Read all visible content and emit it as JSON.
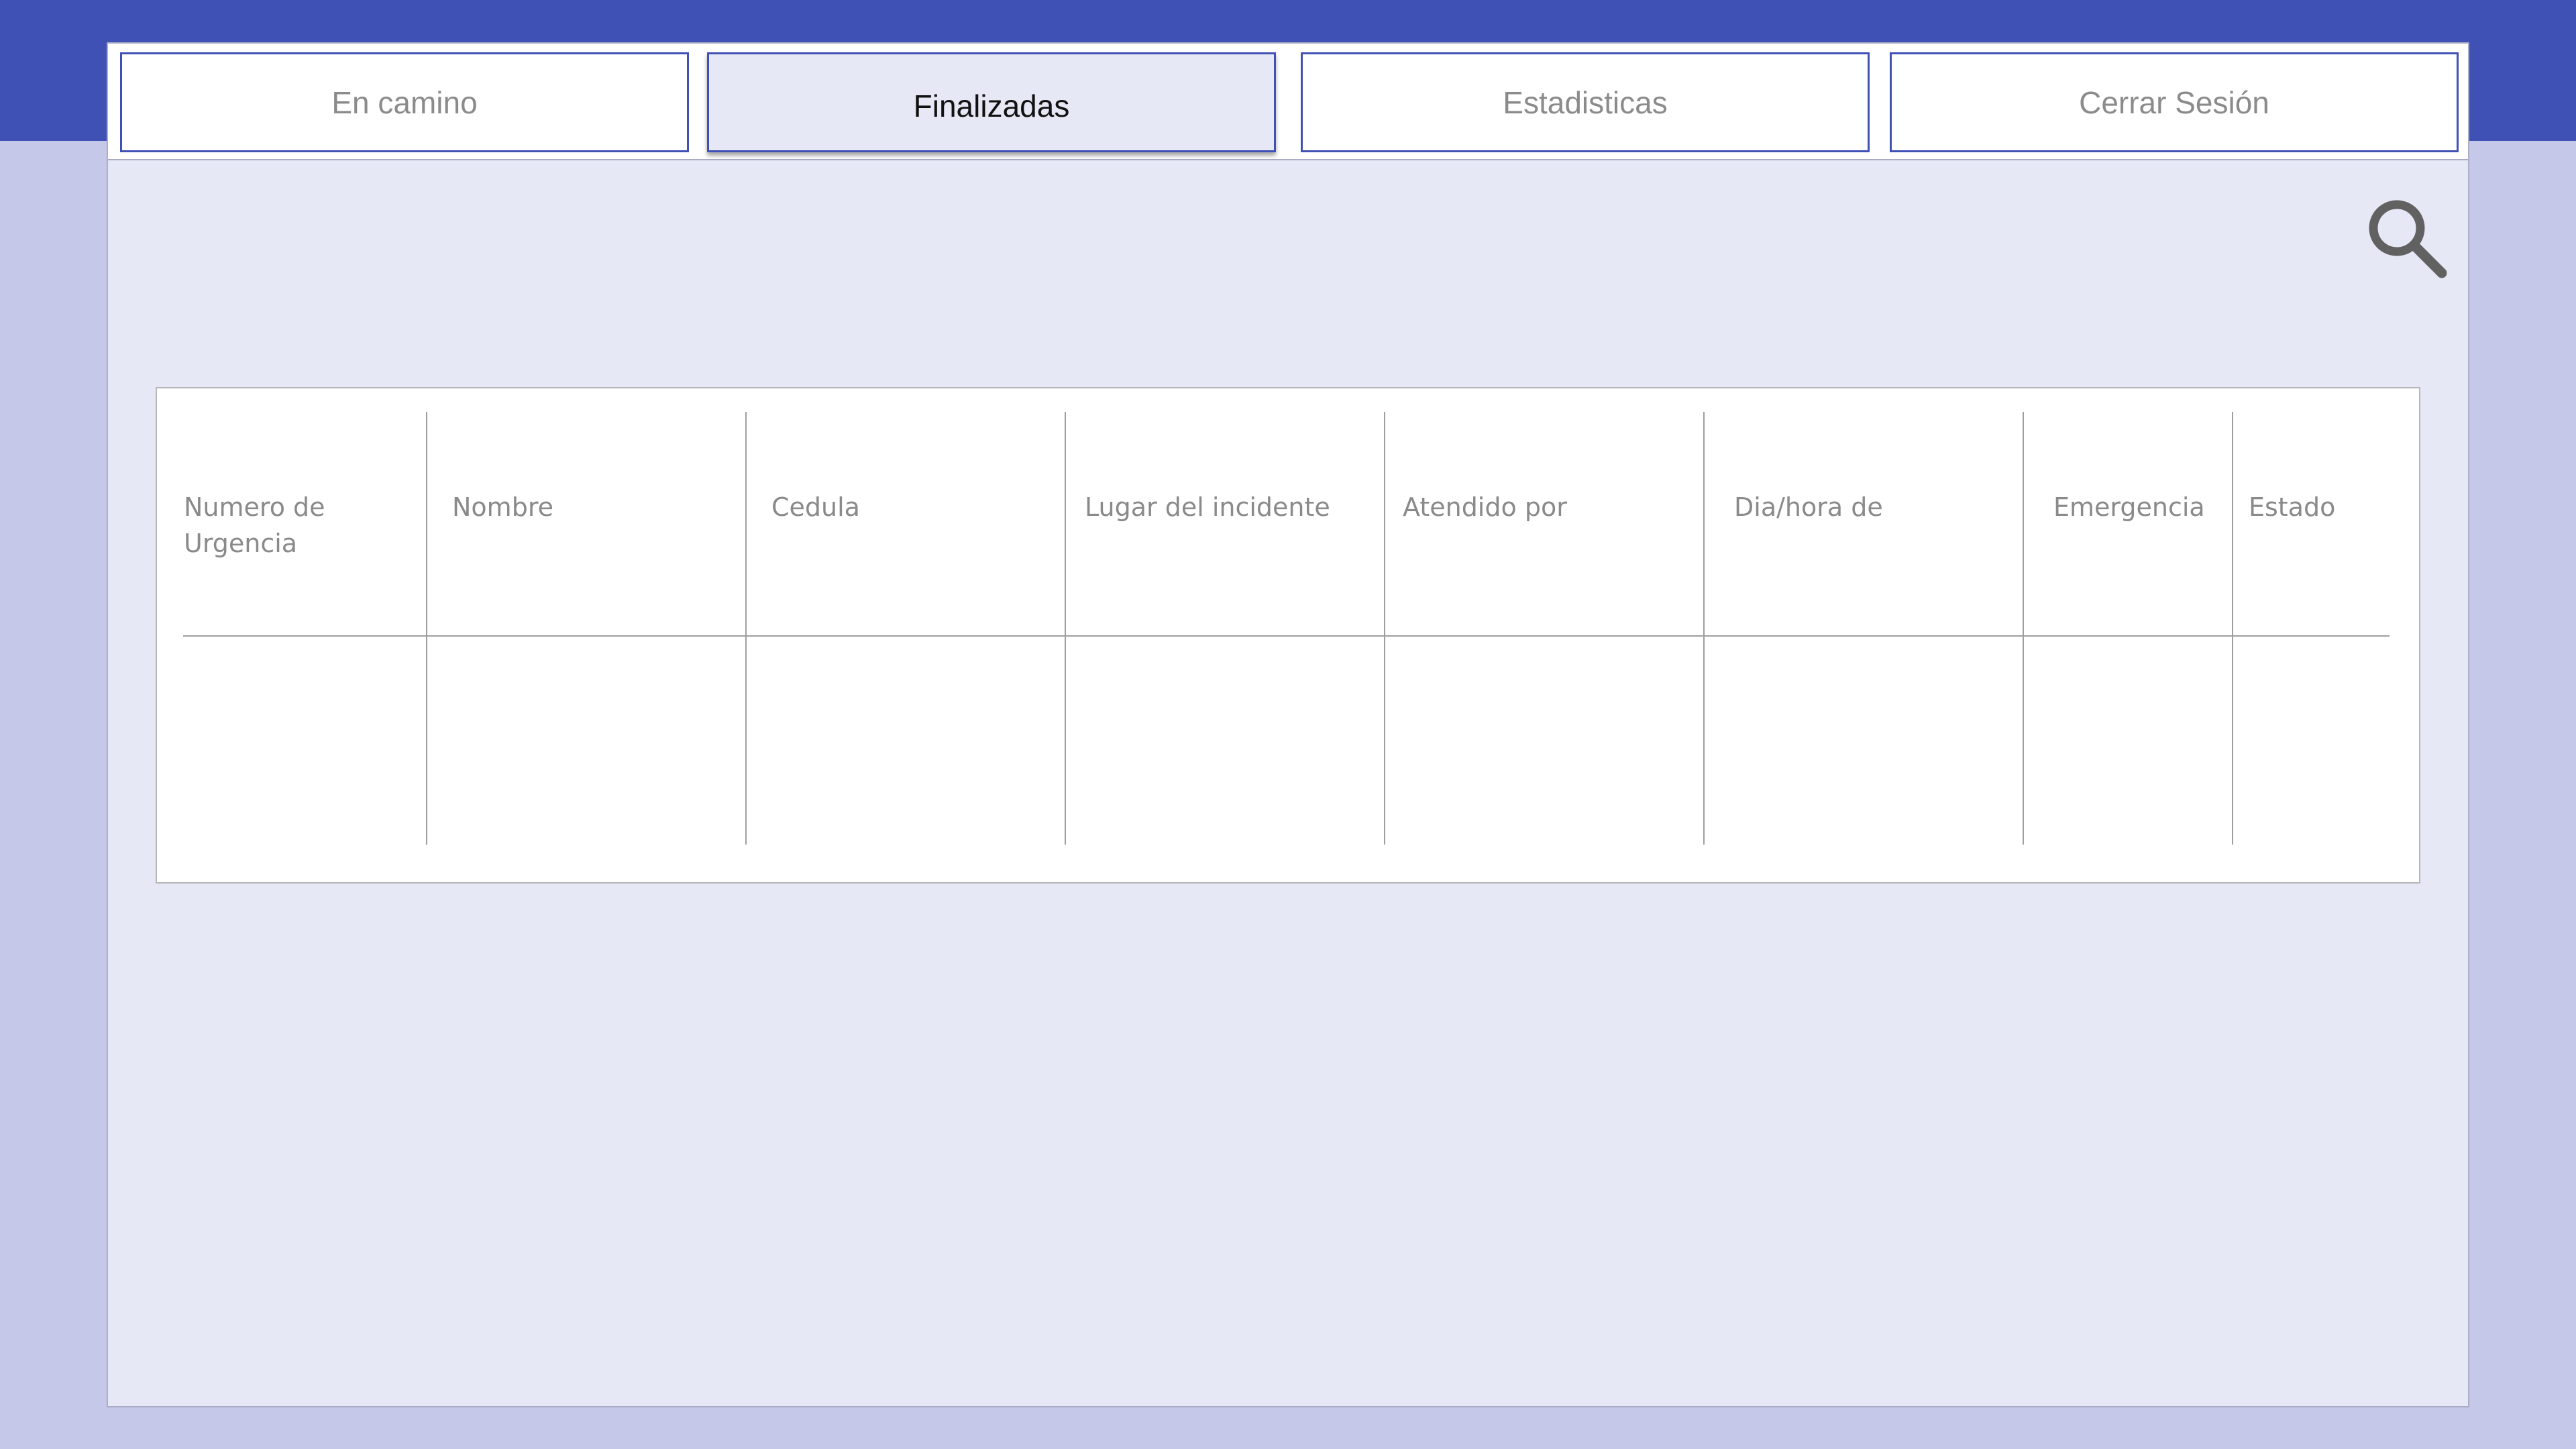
{
  "nav": {
    "tabs": [
      {
        "label": "En camino",
        "active": false
      },
      {
        "label": "Finalizadas",
        "active": true
      },
      {
        "label": "Estadisticas",
        "active": false
      },
      {
        "label": "Cerrar Sesión",
        "active": false
      }
    ]
  },
  "search": {
    "icon": "search-icon"
  },
  "table": {
    "columns": [
      "Numero de Urgencia",
      "Nombre",
      "Cedula",
      "Lugar del incidente",
      "Atendido por",
      "Dia/hora de",
      "Emergencia",
      "Estado"
    ],
    "rows": []
  },
  "colors": {
    "primary": "#3f51b5",
    "background": "#c5c8e8",
    "panel": "#e6e8f5",
    "active_tab": "#e6e8f5"
  }
}
